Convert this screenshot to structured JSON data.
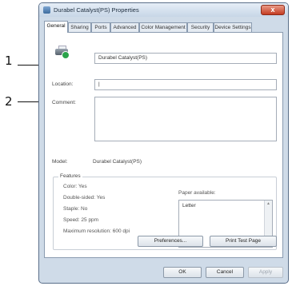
{
  "callouts": {
    "one": "1",
    "two": "2"
  },
  "window": {
    "title": "Durabel Catalyst(PS) Properties",
    "close": "x"
  },
  "tabs": [
    "General",
    "Sharing",
    "Ports",
    "Advanced",
    "Color Management",
    "Security",
    "Device Settings"
  ],
  "general": {
    "printer_name": "Durabel Catalyst(PS)",
    "location_label": "Location:",
    "location_value": "|",
    "comment_label": "Comment:",
    "comment_value": "",
    "model_label": "Model:",
    "model_value": "Durabel Catalyst(PS)"
  },
  "features": {
    "title": "Features",
    "color": "Color: Yes",
    "double_sided": "Double-sided: Yes",
    "staple": "Staple: No",
    "speed": "Speed: 25 ppm",
    "max_resolution": "Maximum resolution: 600 dpi",
    "paper_label": "Paper available:",
    "paper_items": [
      "Letter"
    ]
  },
  "buttons": {
    "preferences": "Preferences...",
    "print_test": "Print Test Page",
    "ok": "OK",
    "cancel": "Cancel",
    "apply": "Apply"
  }
}
